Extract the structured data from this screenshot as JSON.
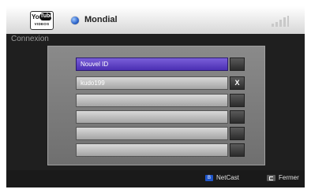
{
  "header": {
    "logo": {
      "you": "You",
      "tube": "Tube",
      "sub": "VIDEOS"
    },
    "region_label": "Mondial"
  },
  "section_title": "Connexion",
  "accounts": {
    "rows": [
      {
        "label": "Nouvel ID",
        "side": "",
        "selected": true
      },
      {
        "label": "kudo199",
        "side": "X",
        "selected": false
      },
      {
        "label": "",
        "side": "",
        "selected": false
      },
      {
        "label": "",
        "side": "",
        "selected": false
      },
      {
        "label": "",
        "side": "",
        "selected": false
      },
      {
        "label": "",
        "side": "",
        "selected": false
      }
    ]
  },
  "footer": {
    "netcast_key": "B",
    "netcast_label": "NetCast",
    "exit_label": "Fermer"
  },
  "colors": {
    "selected_row": "#5a3cc4",
    "blue_key": "#1f55c9"
  }
}
